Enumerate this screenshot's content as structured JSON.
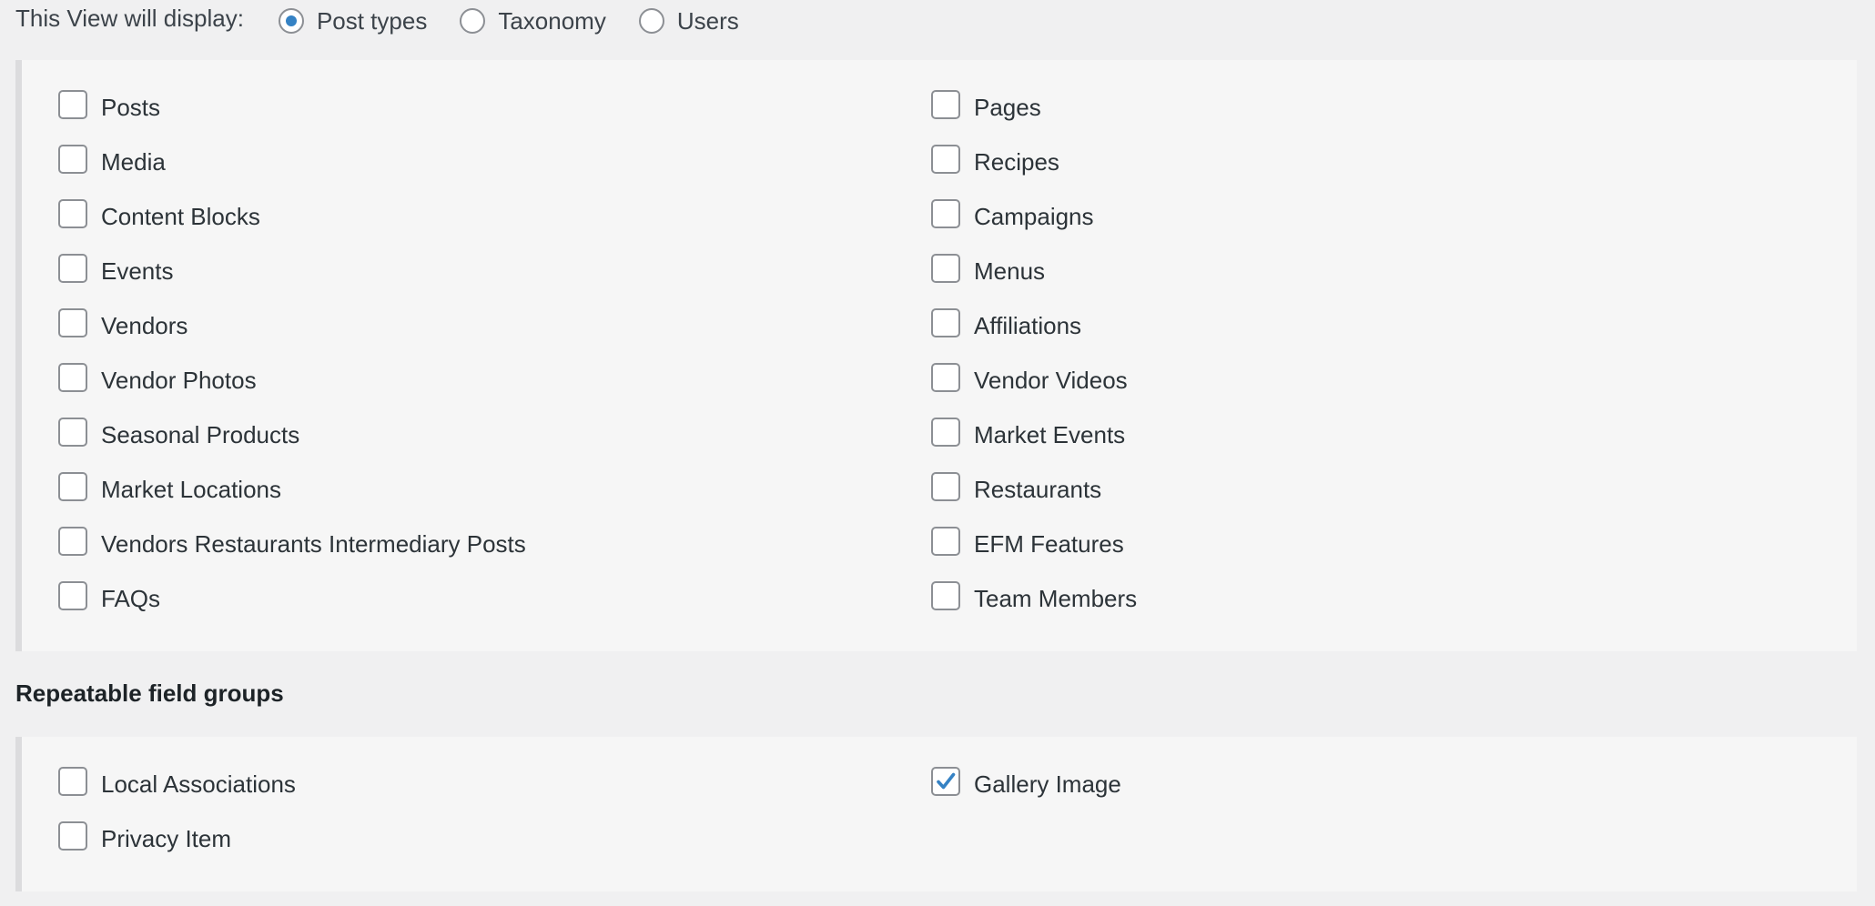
{
  "display": {
    "label": "This View will display:",
    "options": [
      {
        "label": "Post types",
        "checked": true
      },
      {
        "label": "Taxonomy",
        "checked": false
      },
      {
        "label": "Users",
        "checked": false
      }
    ]
  },
  "post_types": {
    "left": [
      {
        "label": "Posts",
        "checked": false
      },
      {
        "label": "Media",
        "checked": false
      },
      {
        "label": "Content Blocks",
        "checked": false
      },
      {
        "label": "Events",
        "checked": false
      },
      {
        "label": "Vendors",
        "checked": false
      },
      {
        "label": "Vendor Photos",
        "checked": false
      },
      {
        "label": "Seasonal Products",
        "checked": false
      },
      {
        "label": "Market Locations",
        "checked": false
      },
      {
        "label": "Vendors Restaurants Intermediary Posts",
        "checked": false
      },
      {
        "label": "FAQs",
        "checked": false
      }
    ],
    "right": [
      {
        "label": "Pages",
        "checked": false
      },
      {
        "label": "Recipes",
        "checked": false
      },
      {
        "label": "Campaigns",
        "checked": false
      },
      {
        "label": "Menus",
        "checked": false
      },
      {
        "label": "Affiliations",
        "checked": false
      },
      {
        "label": "Vendor Videos",
        "checked": false
      },
      {
        "label": "Market Events",
        "checked": false
      },
      {
        "label": "Restaurants",
        "checked": false
      },
      {
        "label": "EFM Features",
        "checked": false
      },
      {
        "label": "Team Members",
        "checked": false
      }
    ]
  },
  "repeatable": {
    "title": "Repeatable field groups",
    "left": [
      {
        "label": "Local Associations",
        "checked": false
      },
      {
        "label": "Privacy Item",
        "checked": false
      }
    ],
    "right": [
      {
        "label": "Gallery Image",
        "checked": true
      }
    ]
  },
  "colors": {
    "accent": "#3582c4",
    "page_bg": "#f0f0f1",
    "panel_bg": "#f6f6f6",
    "border": "#8c8f94"
  },
  "icons": {
    "checkmark": "checkmark-icon"
  }
}
